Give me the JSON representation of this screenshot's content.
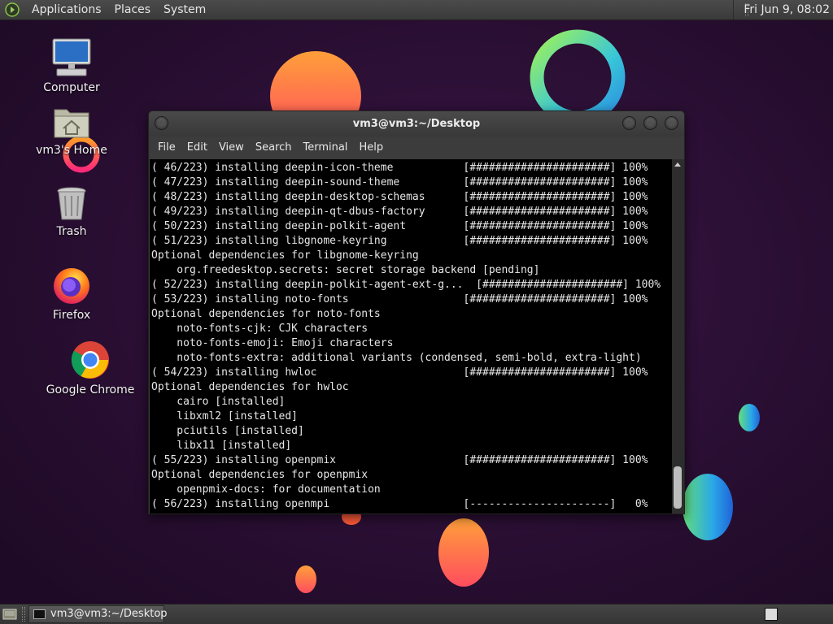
{
  "top_panel": {
    "menus": [
      "Applications",
      "Places",
      "System"
    ],
    "clock": "Fri Jun  9, 08:02"
  },
  "desktop_icons": [
    {
      "label": "Computer",
      "icon": "computer-icon"
    },
    {
      "label": "vm3's Home",
      "icon": "home-folder-icon"
    },
    {
      "label": "Trash",
      "icon": "trash-icon"
    },
    {
      "label": "Firefox",
      "icon": "firefox-icon"
    },
    {
      "label": "Google Chrome",
      "icon": "chrome-icon"
    }
  ],
  "terminal": {
    "title": "vm3@vm3:~/Desktop",
    "menu": [
      "File",
      "Edit",
      "View",
      "Search",
      "Terminal",
      "Help"
    ],
    "lines": [
      "( 46/223) installing deepin-icon-theme           [######################] 100%",
      "( 47/223) installing deepin-sound-theme          [######################] 100%",
      "( 48/223) installing deepin-desktop-schemas      [######################] 100%",
      "( 49/223) installing deepin-qt-dbus-factory      [######################] 100%",
      "( 50/223) installing deepin-polkit-agent         [######################] 100%",
      "( 51/223) installing libgnome-keyring            [######################] 100%",
      "Optional dependencies for libgnome-keyring",
      "    org.freedesktop.secrets: secret storage backend [pending]",
      "( 52/223) installing deepin-polkit-agent-ext-g...  [######################] 100%",
      "( 53/223) installing noto-fonts                  [######################] 100%",
      "Optional dependencies for noto-fonts",
      "    noto-fonts-cjk: CJK characters",
      "    noto-fonts-emoji: Emoji characters",
      "    noto-fonts-extra: additional variants (condensed, semi-bold, extra-light)",
      "( 54/223) installing hwloc                       [######################] 100%",
      "Optional dependencies for hwloc",
      "    cairo [installed]",
      "    libxml2 [installed]",
      "    pciutils [installed]",
      "    libx11 [installed]",
      "( 55/223) installing openpmix                    [######################] 100%",
      "Optional dependencies for openpmix",
      "    openpmix-docs: for documentation",
      "( 56/223) installing openmpi                     [----------------------]   0%"
    ]
  },
  "taskbar": {
    "task_label": "vm3@vm3:~/Desktop"
  },
  "colors": {
    "wallpaper": "#2a0f33",
    "panel": "#3f3f3f",
    "terminal_bg": "#000000",
    "terminal_fg": "#e6e6e6"
  }
}
